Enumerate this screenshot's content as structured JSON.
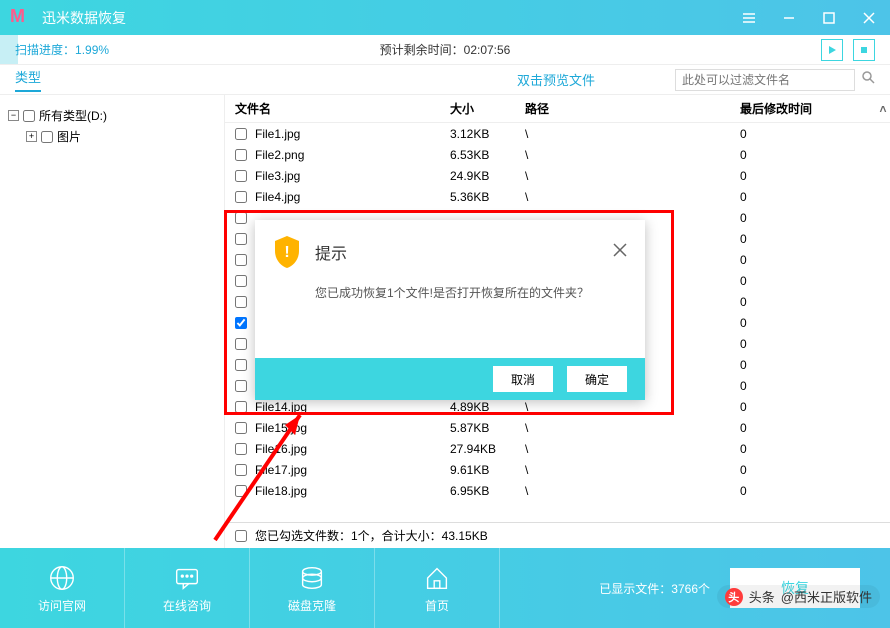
{
  "app": {
    "title": "迅米数据恢复"
  },
  "progress": {
    "scan_prefix": "扫描进度：",
    "scan_percent": "1.99%",
    "countdown_prefix": "预计剩余时间：",
    "countdown_value": "02:07:56"
  },
  "toolbar": {
    "type_tab": "类型",
    "preview_hint": "双击预览文件",
    "search_placeholder": "此处可以过滤文件名"
  },
  "tree": {
    "root": "所有类型(D:)",
    "child": "图片"
  },
  "columns": {
    "name": "文件名",
    "size": "大小",
    "path": "路径",
    "time": "最后修改时间"
  },
  "files": [
    {
      "name": "File1.jpg",
      "size": "3.12KB",
      "path": "\\",
      "time": "0",
      "checked": false
    },
    {
      "name": "File2.png",
      "size": "6.53KB",
      "path": "\\",
      "time": "0",
      "checked": false
    },
    {
      "name": "File3.jpg",
      "size": "24.9KB",
      "path": "\\",
      "time": "0",
      "checked": false
    },
    {
      "name": "File4.jpg",
      "size": "5.36KB",
      "path": "\\",
      "time": "0",
      "checked": false
    },
    {
      "name": "",
      "size": "",
      "path": "",
      "time": "0",
      "checked": false
    },
    {
      "name": "",
      "size": "",
      "path": "",
      "time": "0",
      "checked": false
    },
    {
      "name": "",
      "size": "",
      "path": "",
      "time": "0",
      "checked": false
    },
    {
      "name": "",
      "size": "",
      "path": "",
      "time": "0",
      "checked": false
    },
    {
      "name": "",
      "size": "",
      "path": "",
      "time": "0",
      "checked": false
    },
    {
      "name": "",
      "size": "",
      "path": "",
      "time": "0",
      "checked": true
    },
    {
      "name": "",
      "size": "",
      "path": "",
      "time": "0",
      "checked": false
    },
    {
      "name": "",
      "size": "",
      "path": "",
      "time": "0",
      "checked": false
    },
    {
      "name": "",
      "size": "",
      "path": "",
      "time": "0",
      "checked": false
    },
    {
      "name": "File14.jpg",
      "size": "4.89KB",
      "path": "\\",
      "time": "0",
      "checked": false
    },
    {
      "name": "File15.jpg",
      "size": "5.87KB",
      "path": "\\",
      "time": "0",
      "checked": false
    },
    {
      "name": "File16.jpg",
      "size": "27.94KB",
      "path": "\\",
      "time": "0",
      "checked": false
    },
    {
      "name": "File17.jpg",
      "size": "9.61KB",
      "path": "\\",
      "time": "0",
      "checked": false
    },
    {
      "name": "File18.jpg",
      "size": "6.95KB",
      "path": "\\",
      "time": "0",
      "checked": false
    }
  ],
  "summary": {
    "text": "您已勾选文件数：1个，合计大小：43.15KB"
  },
  "footer": {
    "website": "访问官网",
    "chat": "在线咨询",
    "clone": "磁盘克隆",
    "home": "首页",
    "shown_prefix": "已显示文件：",
    "shown_count": "3766个",
    "recover": "恢复"
  },
  "dialog": {
    "title": "提示",
    "message": "您已成功恢复1个文件!是否打开恢复所在的文件夹？",
    "cancel": "取消",
    "ok": "确定"
  },
  "watermark": {
    "prefix": "头条",
    "author": "@西米正版软件"
  }
}
